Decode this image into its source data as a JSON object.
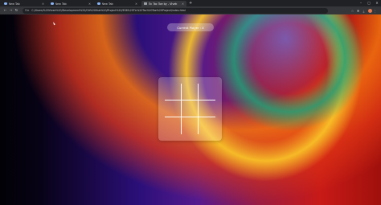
{
  "browser": {
    "tabs": [
      {
        "title": "New Tab",
        "active": false
      },
      {
        "title": "New Tab",
        "active": false
      },
      {
        "title": "New Tab",
        "active": false
      },
      {
        "title": "Tic Tac Toe by - Vivek",
        "active": true
      }
    ],
    "new_tab_symbol": "+",
    "window_controls": {
      "minimize": "–",
      "maximize": "▢",
      "close": "✕"
    },
    "address": {
      "scheme": "File",
      "url": "C:/Users/%20Vivek%20/Development%20/Git%20Hub%20/Project%20/ES6%20Tic%20Tac%20Toe%20Project/index.html"
    },
    "icons": {
      "back": "back-icon",
      "forward": "forward-icon",
      "reload": "reload-icon",
      "info": "info-icon",
      "bookmark": "star-icon",
      "extensions": "extensions-icon",
      "menu": "menu-icon"
    }
  },
  "game": {
    "current_player_label": "Current Player : X",
    "board": [
      "",
      "",
      "",
      "",
      "",
      "",
      "",
      "",
      ""
    ]
  },
  "colors": {
    "chrome_dark": "#202124",
    "chrome_toolbar": "#35363a",
    "pill_bg": "rgba(255,255,255,0.28)",
    "board_card_bg": "rgba(255,255,255,0.22)",
    "grid_lines": "#ffffff"
  }
}
